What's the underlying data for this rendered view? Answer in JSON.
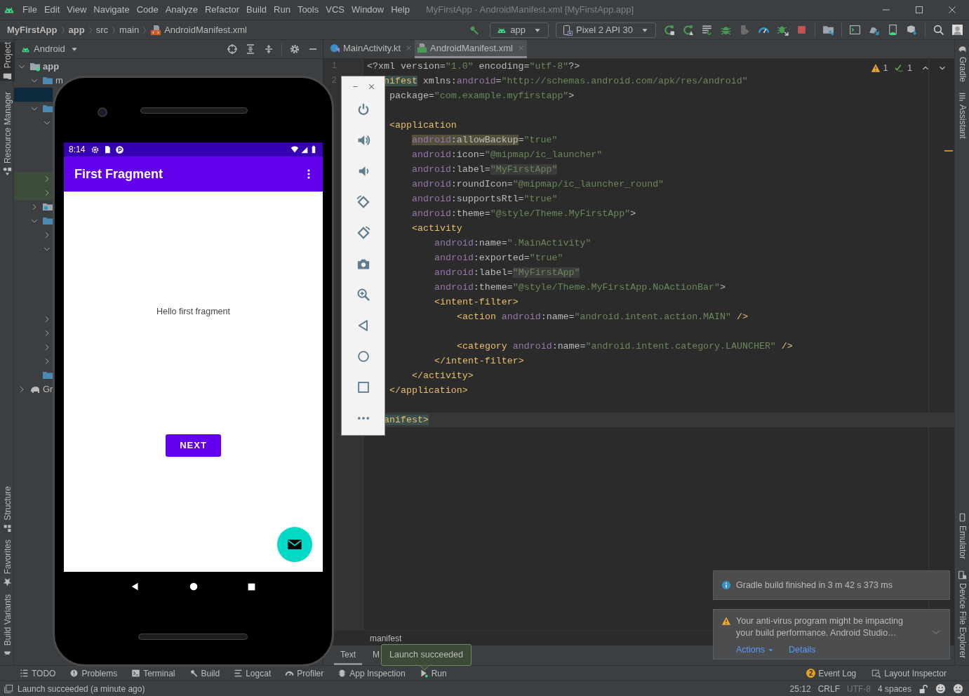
{
  "menu_bar": {
    "items": [
      "File",
      "Edit",
      "View",
      "Navigate",
      "Code",
      "Analyze",
      "Refactor",
      "Build",
      "Run",
      "Tools",
      "VCS",
      "Window",
      "Help"
    ],
    "title": "MyFirstApp - AndroidManifest.xml [MyFirstApp.app]"
  },
  "nav_bar": {
    "breadcrumbs": [
      {
        "label": "MyFirstApp",
        "kind": "project"
      },
      {
        "label": "app",
        "kind": "module"
      },
      {
        "label": "src",
        "kind": "folder"
      },
      {
        "label": "main",
        "kind": "folder"
      },
      {
        "label": "AndroidManifest.xml",
        "kind": "xml"
      }
    ],
    "run_config": "app",
    "device": "Pixel 2 API 30"
  },
  "left_strip": {
    "top": [
      {
        "label": "Project",
        "kind": "project",
        "selected": true
      },
      {
        "label": "Resource Manager",
        "kind": "resources",
        "selected": false
      }
    ],
    "bottom": [
      {
        "label": "Structure",
        "kind": "structure",
        "selected": false
      },
      {
        "label": "Favorites",
        "kind": "favorites",
        "selected": false
      },
      {
        "label": "Build Variants",
        "kind": "variants",
        "selected": false
      }
    ]
  },
  "project_panel": {
    "view": "Android",
    "tree": [
      {
        "label": "app",
        "kind": "module",
        "expanded": true,
        "selected": false,
        "highlighted": false,
        "children": [
          {
            "label": "m",
            "kind": "folder",
            "expanded": true,
            "selected": false,
            "highlighted": false,
            "children": [
              {
                "selected": true,
                "highlighted": false
              }
            ]
          },
          {
            "kind": "folder",
            "expanded": true,
            "selected": false,
            "highlighted": false,
            "children": [
              {
                "expanded": true,
                "selected": false,
                "highlighted": false
              },
              {
                "expanded": false,
                "selected": false,
                "highlighted": true
              },
              {
                "expanded": false,
                "selected": false,
                "highlighted": true
              }
            ]
          },
          {
            "kind": "package",
            "expanded": false,
            "selected": false,
            "highlighted": false
          },
          {
            "kind": "folder",
            "expanded": true,
            "selected": false,
            "highlighted": false,
            "children": [
              {
                "expanded": false,
                "selected": false,
                "highlighted": false
              },
              {
                "expanded": true,
                "selected": false,
                "highlighted": false
              },
              {
                "expanded": false,
                "selected": false,
                "highlighted": false
              },
              {
                "expanded": false,
                "selected": false,
                "highlighted": false
              },
              {
                "expanded": false,
                "selected": false,
                "highlighted": false
              },
              {
                "expanded": false,
                "selected": false,
                "highlighted": false
              }
            ]
          },
          {
            "kind": "folder",
            "selected": false,
            "highlighted": false
          }
        ]
      },
      {
        "label": "Gr",
        "kind": "gradle",
        "expanded": false,
        "selected": false,
        "highlighted": false
      }
    ]
  },
  "editor": {
    "tabs": [
      {
        "label": "MainActivity.kt",
        "kind": "kotlin",
        "selected": false
      },
      {
        "label": "AndroidManifest.xml",
        "kind": "manifest",
        "selected": true
      }
    ],
    "warnings": "1",
    "weak_warnings": "1",
    "lines": [
      {
        "number": "1",
        "current": false,
        "tokens": [
          {
            "kind": "attr",
            "text": "<?xml version=",
            "highlighted": false
          },
          {
            "kind": "str",
            "text": "\"1.0\"",
            "highlighted": false
          },
          {
            "kind": "attr",
            "text": " encoding=",
            "highlighted": false
          },
          {
            "kind": "str",
            "text": "\"utf-8\"",
            "highlighted": false
          },
          {
            "kind": "attr",
            "text": "?>",
            "highlighted": false
          }
        ]
      },
      {
        "number": "2",
        "current": false,
        "tokens": [
          {
            "kind": "tag",
            "text": "   nifest",
            "highlighted": true
          },
          {
            "kind": "attr",
            "text": " xmlns:",
            "highlighted": false
          },
          {
            "kind": "ns",
            "text": "android",
            "highlighted": false
          },
          {
            "kind": "attr",
            "text": "=",
            "highlighted": false
          },
          {
            "kind": "str",
            "text": "\"http://schemas.android.com/apk/res/android\"",
            "highlighted": false
          }
        ]
      },
      {
        "current": false,
        "tokens": [
          {
            "kind": "attr",
            "text": "    package=",
            "highlighted": false
          },
          {
            "kind": "str",
            "text": "\"com.example.myfirstapp\"",
            "highlighted": false
          },
          {
            "kind": "attr",
            "text": ">",
            "highlighted": false
          }
        ]
      },
      {
        "current": false
      },
      {
        "current": false,
        "tokens": [
          {
            "kind": "tag",
            "text": "    <application",
            "highlighted": false
          }
        ]
      },
      {
        "current": false,
        "tokens": [
          {
            "kind": "ns",
            "text": "        android",
            "highlighted": true
          },
          {
            "kind": "attr",
            "text": ":allowBackup",
            "highlighted": true
          },
          {
            "kind": "attr",
            "text": "=",
            "highlighted": false
          },
          {
            "kind": "str",
            "text": "\"true\"",
            "highlighted": false
          }
        ]
      },
      {
        "current": false,
        "tokens": [
          {
            "kind": "ns",
            "text": "        android",
            "highlighted": false
          },
          {
            "kind": "attr",
            "text": ":icon=",
            "highlighted": false
          },
          {
            "kind": "str",
            "text": "\"@mipmap/ic_launcher\"",
            "highlighted": false
          }
        ]
      },
      {
        "current": false,
        "tokens": [
          {
            "kind": "ns",
            "text": "        android",
            "highlighted": false
          },
          {
            "kind": "attr",
            "text": ":label=",
            "highlighted": false
          },
          {
            "kind": "str",
            "text": "\"MyFirstApp\"",
            "highlighted": true
          }
        ]
      },
      {
        "current": false,
        "tokens": [
          {
            "kind": "ns",
            "text": "        android",
            "highlighted": false
          },
          {
            "kind": "attr",
            "text": ":roundIcon=",
            "highlighted": false
          },
          {
            "kind": "str",
            "text": "\"@mipmap/ic_launcher_round\"",
            "highlighted": false
          }
        ]
      },
      {
        "current": false,
        "tokens": [
          {
            "kind": "ns",
            "text": "        android",
            "highlighted": false
          },
          {
            "kind": "attr",
            "text": ":supportsRtl=",
            "highlighted": false
          },
          {
            "kind": "str",
            "text": "\"true\"",
            "highlighted": false
          }
        ]
      },
      {
        "current": false,
        "tokens": [
          {
            "kind": "ns",
            "text": "        android",
            "highlighted": false
          },
          {
            "kind": "attr",
            "text": ":theme=",
            "highlighted": false
          },
          {
            "kind": "str",
            "text": "\"@style/Theme.MyFirstApp\"",
            "highlighted": false
          },
          {
            "kind": "attr",
            "text": ">",
            "highlighted": false
          }
        ]
      },
      {
        "current": false,
        "tokens": [
          {
            "kind": "tag",
            "text": "        <activity",
            "highlighted": false
          }
        ]
      },
      {
        "current": false,
        "tokens": [
          {
            "kind": "ns",
            "text": "            android",
            "highlighted": false
          },
          {
            "kind": "attr",
            "text": ":name=",
            "highlighted": false
          },
          {
            "kind": "str",
            "text": "\".MainActivity\"",
            "highlighted": false
          }
        ]
      },
      {
        "current": false,
        "tokens": [
          {
            "kind": "ns",
            "text": "            android",
            "highlighted": false
          },
          {
            "kind": "attr",
            "text": ":exported=",
            "highlighted": false
          },
          {
            "kind": "str",
            "text": "\"true\"",
            "highlighted": false
          }
        ]
      },
      {
        "current": false,
        "tokens": [
          {
            "kind": "ns",
            "text": "            android",
            "highlighted": false
          },
          {
            "kind": "attr",
            "text": ":label=",
            "highlighted": false
          },
          {
            "kind": "str",
            "text": "\"MyFirstApp\"",
            "highlighted": true
          }
        ]
      },
      {
        "current": false,
        "tokens": [
          {
            "kind": "ns",
            "text": "            android",
            "highlighted": false
          },
          {
            "kind": "attr",
            "text": ":theme=",
            "highlighted": false
          },
          {
            "kind": "str",
            "text": "\"@style/Theme.MyFirstApp.NoActionBar\"",
            "highlighted": false
          },
          {
            "kind": "attr",
            "text": ">",
            "highlighted": false
          }
        ]
      },
      {
        "current": false,
        "tokens": [
          {
            "kind": "tag",
            "text": "            <intent-filter>",
            "highlighted": false
          }
        ]
      },
      {
        "current": false,
        "tokens": [
          {
            "kind": "tag",
            "text": "                <action ",
            "highlighted": false
          },
          {
            "kind": "ns",
            "text": "android",
            "highlighted": false
          },
          {
            "kind": "attr",
            "text": ":name=",
            "highlighted": false
          },
          {
            "kind": "str",
            "text": "\"android.intent.action.MAIN\"",
            "highlighted": false
          },
          {
            "kind": "tag",
            "text": " />",
            "highlighted": false
          }
        ]
      },
      {
        "current": false
      },
      {
        "current": false,
        "tokens": [
          {
            "kind": "tag",
            "text": "                <category ",
            "highlighted": false
          },
          {
            "kind": "ns",
            "text": "android",
            "highlighted": false
          },
          {
            "kind": "attr",
            "text": ":name=",
            "highlighted": false
          },
          {
            "kind": "str",
            "text": "\"android.intent.category.LAUNCHER\"",
            "highlighted": false
          },
          {
            "kind": "tag",
            "text": " />",
            "highlighted": false
          }
        ]
      },
      {
        "current": false,
        "tokens": [
          {
            "kind": "tag",
            "text": "            </intent-filter>",
            "highlighted": false
          }
        ]
      },
      {
        "current": false,
        "tokens": [
          {
            "kind": "tag",
            "text": "        </activity>",
            "highlighted": false
          }
        ]
      },
      {
        "current": false,
        "tokens": [
          {
            "kind": "tag",
            "text": "    </application>",
            "highlighted": false
          }
        ]
      },
      {
        "current": false
      },
      {
        "current": true,
        "tokens": [
          {
            "kind": "tag",
            "text": "   anifest>",
            "highlighted": true
          }
        ]
      }
    ],
    "breadcrumb": "manifest",
    "mode_tabs": [
      {
        "label": "Text",
        "selected": true
      },
      {
        "label": "M",
        "selected": false
      }
    ]
  },
  "right_strip": {
    "top": [
      {
        "label": "Gradle",
        "kind": "gradle"
      },
      {
        "label": "Assistant",
        "kind": "assistant"
      }
    ],
    "bottom": [
      {
        "label": "Emulator",
        "kind": "emulator"
      },
      {
        "label": "Device File Explorer",
        "kind": "device_files"
      }
    ]
  },
  "emulator": {
    "status_time": "8:14",
    "app_title": "First Fragment",
    "body_text": "Hello first fragment",
    "button": "NEXT"
  },
  "notifications": [
    {
      "kind": "info",
      "text": "Gradle build finished in 3 m 42 s 373 ms"
    },
    {
      "kind": "warning",
      "text": "Your anti-virus program might be impacting your build performance. Android Studio…",
      "actions": [
        "Actions",
        "Details"
      ]
    }
  ],
  "tooltip": "Launch succeeded",
  "tool_windows": {
    "left": [
      {
        "label": "TODO",
        "kind": "todo"
      },
      {
        "label": "Problems",
        "kind": "problems"
      },
      {
        "label": "Terminal",
        "kind": "terminal"
      },
      {
        "label": "Build",
        "kind": "build"
      },
      {
        "label": "Logcat",
        "kind": "logcat"
      },
      {
        "label": "Profiler",
        "kind": "profiler"
      },
      {
        "label": "App Inspection",
        "kind": "inspection"
      },
      {
        "label": "Run",
        "kind": "run"
      }
    ],
    "right": [
      {
        "label": "Event Log",
        "kind": "event_log",
        "badge": "2"
      },
      {
        "label": "Layout Inspector",
        "kind": "layout_inspector"
      }
    ]
  },
  "status_bar": {
    "message": "Launch succeeded (a minute ago)",
    "position": "25:12",
    "line_separator": "CRLF",
    "encoding": {
      "label": "UTF-8",
      "disabled": true
    },
    "indent": "4 spaces"
  }
}
